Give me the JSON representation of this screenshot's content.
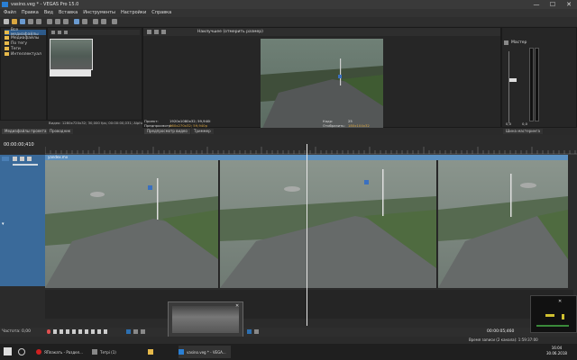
{
  "window": {
    "title": "vasino.veg * - VEGAS Pro 15.0",
    "minimize_glyph": "—",
    "maximize_glyph": "☐",
    "close_glyph": "✕"
  },
  "menu": [
    "Файл",
    "Правка",
    "Вид",
    "Вставка",
    "Инструменты",
    "Настройки",
    "Справка"
  ],
  "explorer": {
    "items": [
      "Все медиафайлы",
      "Медиафайлы",
      "По тегу",
      "Теги",
      "Интеллектуал"
    ]
  },
  "media_info": "Видео: 1280x720x32; 30,000 fps; 00:00:00,031; Alpha",
  "preview": {
    "mode_label": "Наилучшее (отмерить размер)",
    "project_label": "Проект:",
    "project_value": "1920x1080x32; 59,940i",
    "preview_label": "Предпросмотр:",
    "preview_value": "960x270x32; 59,940p",
    "frame_label": "Кадр:",
    "frame_value": "25",
    "display_label": "Отобразить:",
    "display_value": "180x104x32"
  },
  "mixer": {
    "title": "Мастер",
    "bottom_values": [
      "0,0",
      "0,0"
    ]
  },
  "tabs": [
    "Медиафайлы проекта",
    "Проводник",
    "Переходы",
    "Видеоэффекты"
  ],
  "preview_tabs": [
    "Предпросмотр видео",
    "Триммер"
  ],
  "mixer_tab": "Шина мастеринга",
  "timeline": {
    "timecode": "00:00:00;410",
    "clip_name": "yandex.mx",
    "end_timecode": "00:00:05;460",
    "rate_label": "Частота: 0,00"
  },
  "status": {
    "record_time": "Время записи (2 канала): 1:59:37:00"
  },
  "taskbar": {
    "items": [
      "ЯПлакать - Раздел...",
      "Тетрі (1)",
      "",
      "vasino.veg * - VEGA..."
    ],
    "time": "16:04",
    "date": "30.06.2018"
  },
  "colors": {
    "accent": "#2d5a8a",
    "track_blue": "#3a6a9a",
    "clip_label": "#5a8fc0",
    "folder": "#e6b94a"
  }
}
